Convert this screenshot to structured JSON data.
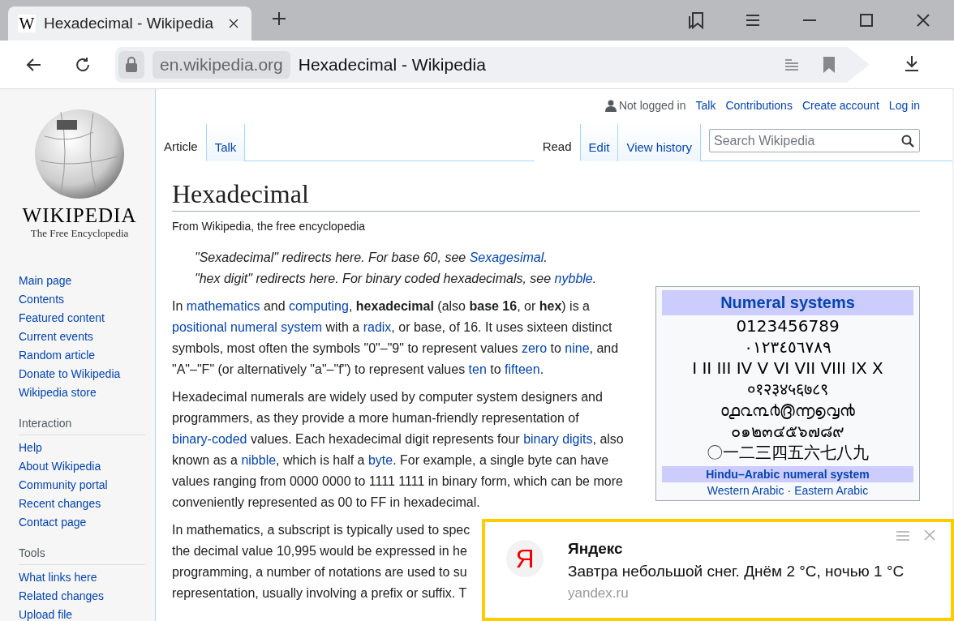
{
  "browser": {
    "tab": {
      "favicon": "W",
      "title": "Hexadecimal - Wikipedia",
      "selected": true
    },
    "address": {
      "domain": "en.wikipedia.org",
      "title": "Hexadecimal - Wikipedia"
    }
  },
  "user_bar": {
    "status": "Not logged in",
    "links": [
      "Talk",
      "Contributions",
      "Create account",
      "Log in"
    ]
  },
  "logo": {
    "wordmark": "WIKIPEDIA",
    "tagline": "The Free Encyclopedia"
  },
  "sidebar": {
    "items": [
      "Main page",
      "Contents",
      "Featured content",
      "Current events",
      "Random article",
      "Donate to Wikipedia",
      "Wikipedia store"
    ],
    "sections": [
      {
        "heading": "Interaction",
        "items": [
          "Help",
          "About Wikipedia",
          "Community portal",
          "Recent changes",
          "Contact page"
        ]
      },
      {
        "heading": "Tools",
        "items": [
          "What links here",
          "Related changes",
          "Upload file"
        ]
      }
    ]
  },
  "left_tabs": [
    {
      "label": "Article",
      "selected": true
    },
    {
      "label": "Talk",
      "selected": false
    }
  ],
  "right_tabs": [
    {
      "label": "Read",
      "selected": true
    },
    {
      "label": "Edit",
      "selected": false
    },
    {
      "label": "View history",
      "selected": false
    }
  ],
  "search": {
    "placeholder": "Search Wikipedia"
  },
  "article": {
    "title": "Hexadecimal",
    "tagline": "From Wikipedia, the free encyclopedia",
    "hatnotes": [
      [
        {
          "kind": "text",
          "text": "\"Sexadecimal\" redirects here. For base 60, see "
        },
        {
          "kind": "link",
          "text": "Sexagesimal"
        },
        {
          "kind": "text",
          "text": "."
        }
      ],
      [
        {
          "kind": "text",
          "text": "\"hex digit\" redirects here. For binary coded hexadecimals, see "
        },
        {
          "kind": "link",
          "text": "nybble"
        },
        {
          "kind": "text",
          "text": "."
        }
      ]
    ],
    "paragraphs": [
      {
        "kind": "segments",
        "segments": [
          {
            "kind": "text",
            "text": "In "
          },
          {
            "kind": "link",
            "text": "mathematics"
          },
          {
            "kind": "text",
            "text": " and "
          },
          {
            "kind": "link",
            "text": "computing"
          },
          {
            "kind": "text",
            "text": ", "
          },
          {
            "kind": "bold",
            "text": "hexadecimal"
          },
          {
            "kind": "text",
            "text": " (also "
          },
          {
            "kind": "bold",
            "text": "base 16"
          },
          {
            "kind": "text",
            "text": ", or "
          },
          {
            "kind": "bold",
            "text": "hex"
          },
          {
            "kind": "text",
            "text": ") is a "
          },
          {
            "kind": "link",
            "text": "positional numeral system"
          },
          {
            "kind": "text",
            "text": " with a "
          },
          {
            "kind": "link",
            "text": "radix"
          },
          {
            "kind": "text",
            "text": ", or base, of 16. It uses sixteen distinct symbols, most often the symbols \"0\"–\"9\" to represent values "
          },
          {
            "kind": "link",
            "text": "zero"
          },
          {
            "kind": "text",
            "text": " to "
          },
          {
            "kind": "link",
            "text": "nine"
          },
          {
            "kind": "text",
            "text": ", and \"A\"–\"F\" (or alternatively \"a\"–\"f\") to represent values "
          },
          {
            "kind": "link",
            "text": "ten"
          },
          {
            "kind": "text",
            "text": " to "
          },
          {
            "kind": "link",
            "text": "fifteen"
          },
          {
            "kind": "text",
            "text": "."
          }
        ]
      },
      {
        "kind": "segments",
        "segments": [
          {
            "kind": "text",
            "text": "Hexadecimal numerals are widely used by computer system designers and programmers, as they provide a more human-friendly representation of "
          },
          {
            "kind": "link",
            "text": "binary-coded"
          },
          {
            "kind": "text",
            "text": " values. Each hexadecimal digit represents four "
          },
          {
            "kind": "link",
            "text": "binary digits"
          },
          {
            "kind": "text",
            "text": ", also known as a "
          },
          {
            "kind": "link",
            "text": "nibble"
          },
          {
            "kind": "text",
            "text": ", which is half a "
          },
          {
            "kind": "link",
            "text": "byte"
          },
          {
            "kind": "text",
            "text": ". For example, a single byte can have values ranging from 0000 0000 to 1111 1111 in binary form, which can be more conveniently represented as 00 to FF in hexadecimal."
          }
        ]
      },
      {
        "kind": "lines",
        "lines": [
          "In mathematics, a subscript is typically used to spec",
          "the decimal value 10,995 would be expressed in he",
          "programming, a number of notations are used to su",
          "representation, usually involving a prefix or suffix. T"
        ]
      }
    ]
  },
  "infobox": {
    "title": "Numeral systems",
    "numerals": [
      "0123456789",
      "٠١٢٣٤٥٦٧٨٩",
      "I II III IV V VI VII VIII IX X",
      "०१२३४५६७८९",
      "൦൧൨൩൪൫൬൭൮൯",
      "๐๑๒๓๔๕๖๗๘๙",
      "〇一二三四五六七八九"
    ],
    "subheader": "Hindu–Arabic numeral system",
    "links": [
      "Western Arabic",
      "Eastern Arabic"
    ],
    "separator": "·"
  },
  "notification": {
    "logo_letter": "Я",
    "title": "Яндекс",
    "body": "Завтра небольшой снег. Днём 2 °C, ночью 1 °C",
    "source": "yandex.ru"
  }
}
